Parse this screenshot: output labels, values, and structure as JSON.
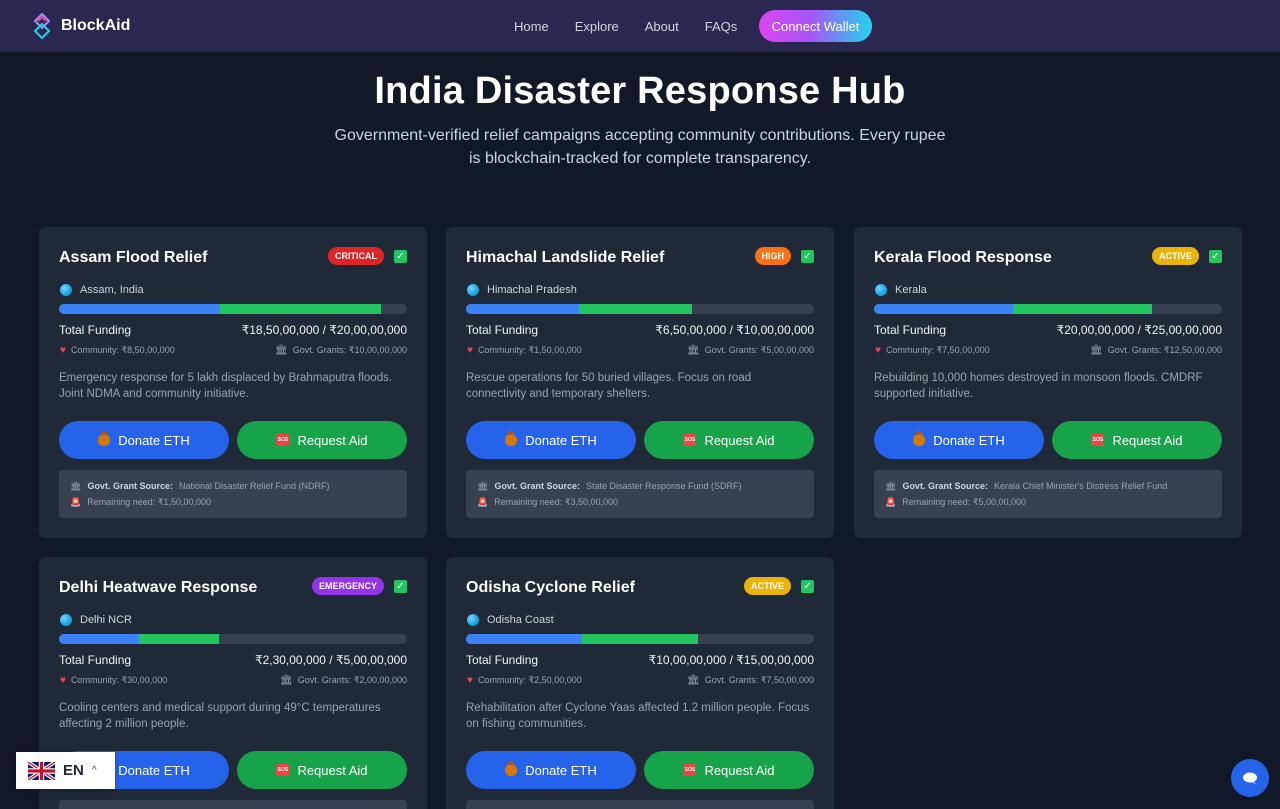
{
  "nav": {
    "brand": "BlockAid",
    "links": [
      "Home",
      "Explore",
      "About",
      "FAQs"
    ],
    "connect_label": "Connect Wallet"
  },
  "hero": {
    "title": "India Disaster Response Hub",
    "subtitle_line1": "Government-verified relief campaigns accepting community contributions. Every rupee",
    "subtitle_line2": "is blockchain-tracked for complete transparency."
  },
  "colors": {
    "critical": "#dc2626",
    "high": "#f97316",
    "active": "#eab308",
    "emergency": "#9333ea",
    "community_bar": "#3b82f6",
    "govt_bar": "#22c55e"
  },
  "cards": [
    {
      "title": "Assam Flood Relief",
      "badge": "CRITICAL",
      "badge_color": "#dc2626",
      "location": "Assam, India",
      "community_fraction": 0.4625,
      "govt_fraction": 0.925,
      "funding_label": "Total Funding",
      "funding_value": "₹18,50,00,000 / ₹20,00,00,000",
      "community": "Community: ₹8,50,00,000",
      "govt": "Govt. Grants: ₹10,00,00,000",
      "description": "Emergency response for 5 lakh displaced by Brahmaputra floods. Joint NDMA and community initiative.",
      "donate_label": "Donate ETH",
      "aid_label": "Request Aid",
      "grant_source_label": "Govt. Grant Source:",
      "grant_source": "National Disaster Relief Fund (NDRF)",
      "remaining": "Remaining need: ₹1,50,00,000"
    },
    {
      "title": "Himachal Landslide Relief",
      "badge": "HIGH",
      "badge_color": "#f97316",
      "location": "Himachal Pradesh",
      "community_fraction": 0.325,
      "govt_fraction": 0.65,
      "funding_label": "Total Funding",
      "funding_value": "₹6,50,00,000 / ₹10,00,00,000",
      "community": "Community: ₹1,50,00,000",
      "govt": "Govt. Grants: ₹5,00,00,000",
      "description": "Rescue operations for 50 buried villages. Focus on road connectivity and temporary shelters.",
      "donate_label": "Donate ETH",
      "aid_label": "Request Aid",
      "grant_source_label": "Govt. Grant Source:",
      "grant_source": "State Disaster Response Fund (SDRF)",
      "remaining": "Remaining need: ₹3,50,00,000"
    },
    {
      "title": "Kerala Flood Response",
      "badge": "ACTIVE",
      "badge_color": "#eab308",
      "location": "Kerala",
      "community_fraction": 0.4,
      "govt_fraction": 0.8,
      "funding_label": "Total Funding",
      "funding_value": "₹20,00,00,000 / ₹25,00,00,000",
      "community": "Community: ₹7,50,00,000",
      "govt": "Govt. Grants: ₹12,50,00,000",
      "description": "Rebuilding 10,000 homes destroyed in monsoon floods. CMDRF supported initiative.",
      "donate_label": "Donate ETH",
      "aid_label": "Request Aid",
      "grant_source_label": "Govt. Grant Source:",
      "grant_source": "Kerala Chief Minister's Distress Relief Fund",
      "remaining": "Remaining need: ₹5,00,00,000"
    },
    {
      "title": "Delhi Heatwave Response",
      "badge": "EMERGENCY",
      "badge_color": "#9333ea",
      "location": "Delhi NCR",
      "community_fraction": 0.23,
      "govt_fraction": 0.46,
      "funding_label": "Total Funding",
      "funding_value": "₹2,30,00,000 / ₹5,00,00,000",
      "community": "Community: ₹30,00,000",
      "govt": "Govt. Grants: ₹2,00,00,000",
      "description": "Cooling centers and medical support during 49°C temperatures affecting 2 million people.",
      "donate_label": "Donate ETH",
      "aid_label": "Request Aid"
    },
    {
      "title": "Odisha Cyclone Relief",
      "badge": "ACTIVE",
      "badge_color": "#eab308",
      "location": "Odisha Coast",
      "community_fraction": 0.333,
      "govt_fraction": 0.667,
      "funding_label": "Total Funding",
      "funding_value": "₹10,00,00,000 / ₹15,00,00,000",
      "community": "Community: ₹2,50,00,000",
      "govt": "Govt. Grants: ₹7,50,00,000",
      "description": "Rehabilitation after Cyclone Yaas affected 1.2 million people. Focus on fishing communities.",
      "donate_label": "Donate ETH",
      "aid_label": "Request Aid"
    }
  ],
  "language": {
    "code": "EN",
    "flag": "uk-flag"
  }
}
